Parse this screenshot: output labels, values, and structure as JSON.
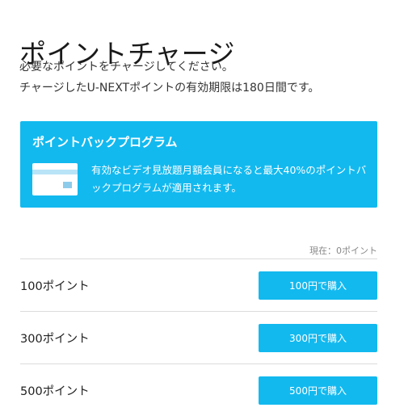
{
  "page": {
    "title": "ポイントチャージ",
    "description_line1": "必要なポイントをチャージしてください。",
    "description_line2": "チャージしたU-NEXTポイントの有効期限は180日間です。"
  },
  "promo": {
    "title": "ポイントバックプログラム",
    "text": "有効なビデオ見放題月額会員になると最大40%のポイントバックプログラムが適用されます。",
    "icon": "credit-card-icon",
    "background_color": "#12b9ef"
  },
  "balance": {
    "text": "現在：0ポイント"
  },
  "charge_options": [
    {
      "label": "100ポイント",
      "button": "100円で購入"
    },
    {
      "label": "300ポイント",
      "button": "300円で購入"
    },
    {
      "label": "500ポイント",
      "button": "500円で購入"
    }
  ],
  "colors": {
    "accent": "#12b9ef"
  }
}
